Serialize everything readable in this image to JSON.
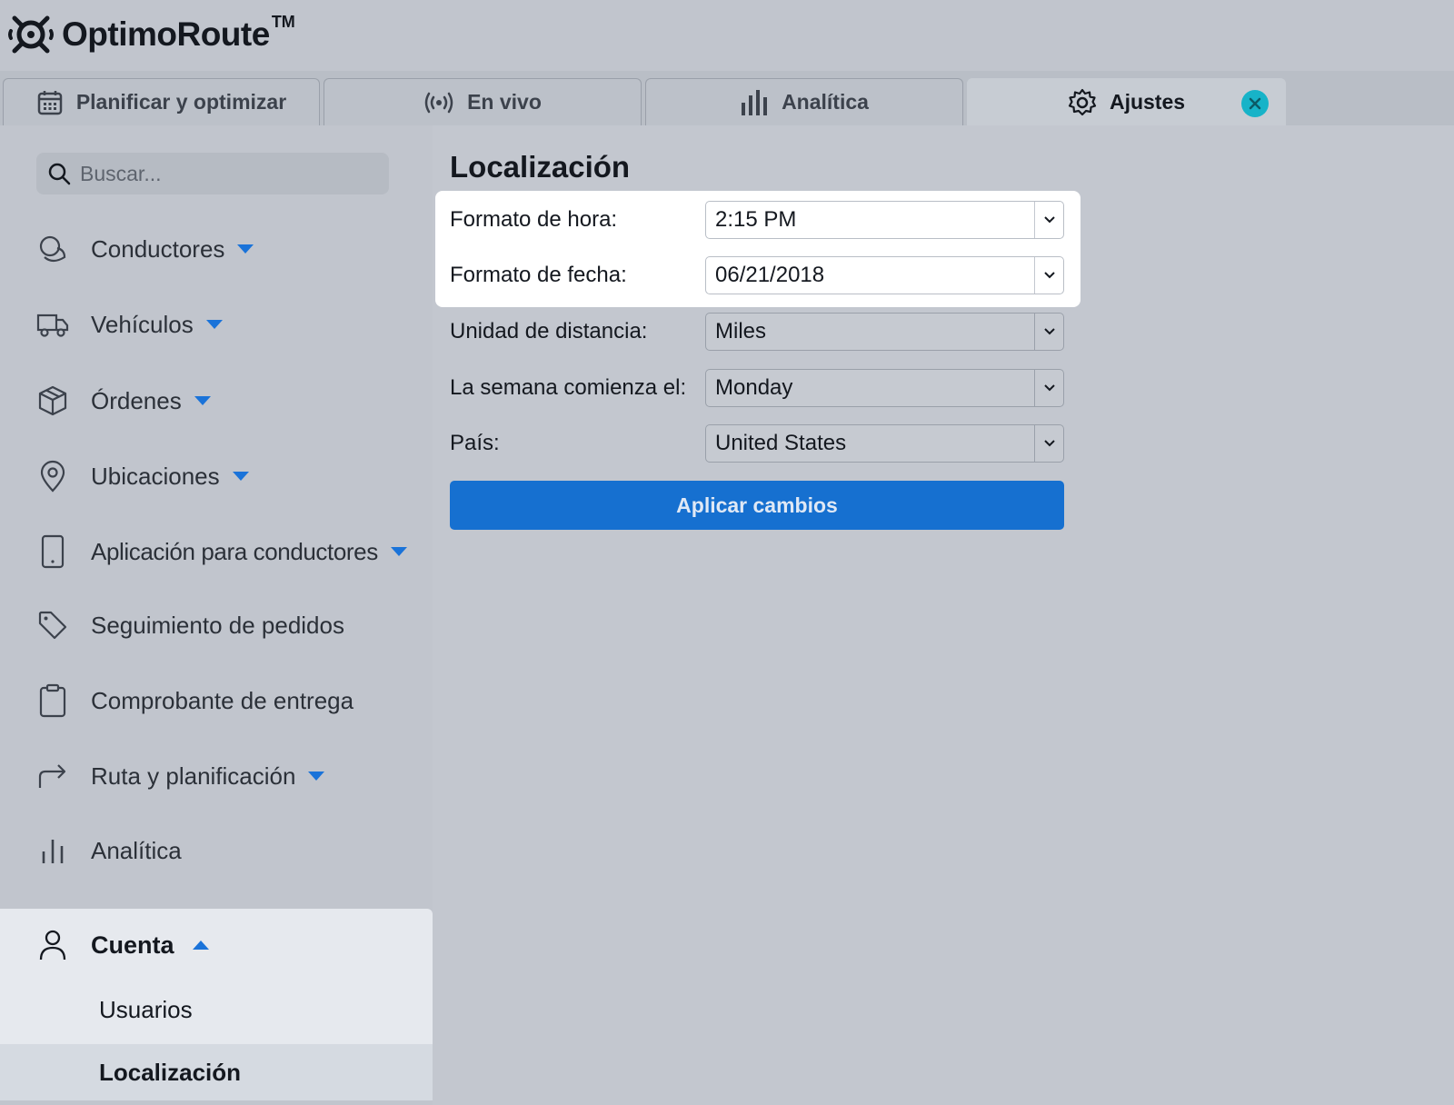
{
  "app": {
    "logo_text": "OptimoRoute",
    "logo_tm": "TM",
    "logo_icon": "optimoroute-logo-icon"
  },
  "tabs": [
    {
      "label": "Planificar y optimizar",
      "icon": "calendar-icon",
      "active": false
    },
    {
      "label": "En vivo",
      "icon": "broadcast-icon",
      "active": false
    },
    {
      "label": "Analítica",
      "icon": "bar-chart-icon",
      "active": false
    },
    {
      "label": "Ajustes",
      "icon": "gear-icon",
      "active": true,
      "close_icon": "close-icon"
    }
  ],
  "sidebar": {
    "search_placeholder": "Buscar...",
    "items": [
      {
        "label": "Conductores",
        "icon": "drivers-icon",
        "expandable": true
      },
      {
        "label": "Vehículos",
        "icon": "truck-icon",
        "expandable": true
      },
      {
        "label": "Órdenes",
        "icon": "box-icon",
        "expandable": true
      },
      {
        "label": "Ubicaciones",
        "icon": "location-pin-icon",
        "expandable": true
      },
      {
        "label": "Aplicación para conductores",
        "icon": "mobile-phone-icon",
        "expandable": true
      },
      {
        "label": "Seguimiento de pedidos",
        "icon": "tag-icon",
        "expandable": false
      },
      {
        "label": "Comprobante de entrega",
        "icon": "clipboard-icon",
        "expandable": false
      },
      {
        "label": "Ruta y planificación",
        "icon": "route-arrow-icon",
        "expandable": true
      },
      {
        "label": "Analítica",
        "icon": "bar-chart-icon",
        "expandable": false
      }
    ],
    "account": {
      "label": "Cuenta",
      "icon": "user-icon",
      "expanded": true,
      "sub_items": [
        {
          "label": "Usuarios",
          "active": false
        },
        {
          "label": "Localización",
          "active": true
        }
      ]
    }
  },
  "main": {
    "title": "Localización",
    "fields": [
      {
        "label": "Formato de hora:",
        "value": "2:15 PM",
        "highlighted": true
      },
      {
        "label": "Formato de fecha:",
        "value": "06/21/2018",
        "highlighted": true
      },
      {
        "label": "Unidad de distancia:",
        "value": "Miles",
        "highlighted": false
      },
      {
        "label": "La semana comienza el:",
        "value": "Monday",
        "highlighted": false
      },
      {
        "label": "País:",
        "value": "United States",
        "highlighted": false
      }
    ],
    "apply_label": "Aplicar cambios"
  },
  "colors": {
    "accent": "#1670d0",
    "close_badge": "#17b3c8",
    "caret": "#1a73d9",
    "background": "#c3c7cf"
  }
}
